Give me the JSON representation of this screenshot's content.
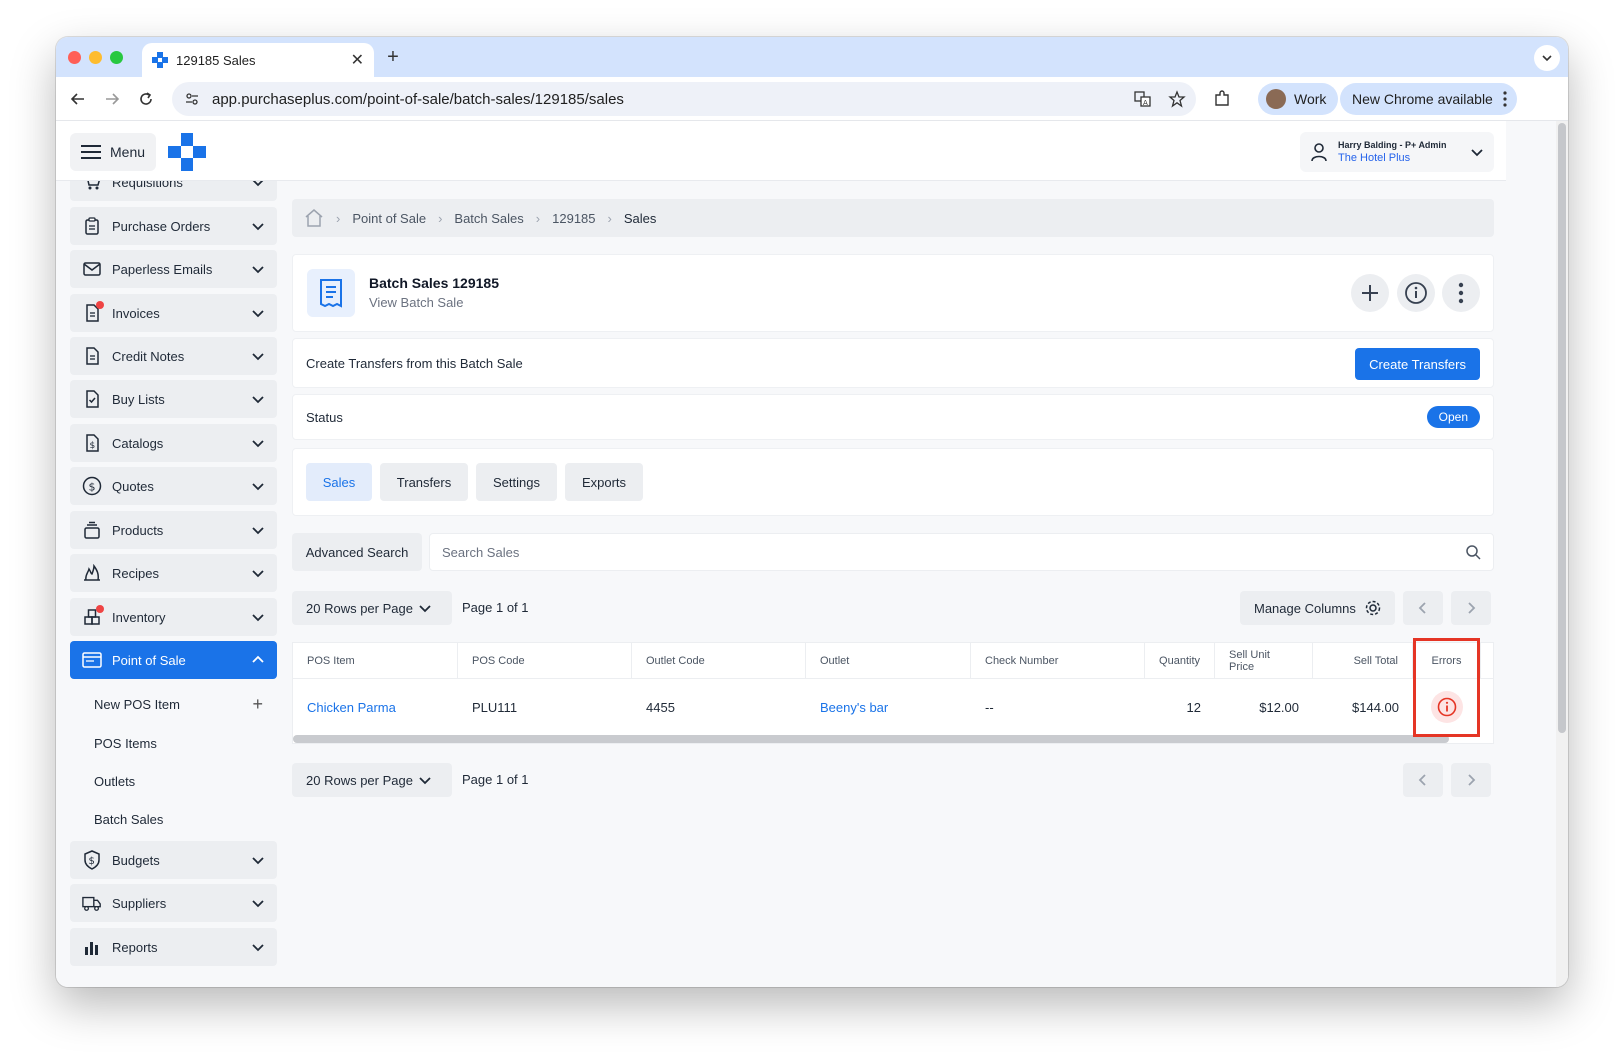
{
  "browser": {
    "tab_title": "129185 Sales",
    "url": "app.purchaseplus.com/point-of-sale/batch-sales/129185/sales",
    "profile_label": "Work",
    "update_label": "New Chrome available"
  },
  "header": {
    "menu_label": "Menu",
    "user_name": "Harry Balding - P+ Admin",
    "user_org": "The Hotel Plus"
  },
  "sidebar": {
    "items": [
      {
        "label": "Requisitions",
        "icon": "cart-icon"
      },
      {
        "label": "Purchase Orders",
        "icon": "clipboard-icon"
      },
      {
        "label": "Paperless Emails",
        "icon": "envelope-icon"
      },
      {
        "label": "Invoices",
        "icon": "invoice-icon"
      },
      {
        "label": "Credit Notes",
        "icon": "document-icon"
      },
      {
        "label": "Buy Lists",
        "icon": "checklist-icon"
      },
      {
        "label": "Catalogs",
        "icon": "catalog-dollar-icon"
      },
      {
        "label": "Quotes",
        "icon": "dollar-circle-icon"
      },
      {
        "label": "Products",
        "icon": "box-stack-icon"
      },
      {
        "label": "Recipes",
        "icon": "flame-icon"
      },
      {
        "label": "Inventory",
        "icon": "inventory-icon"
      },
      {
        "label": "Point of Sale",
        "icon": "pos-icon"
      },
      {
        "label": "Budgets",
        "icon": "shield-dollar-icon"
      },
      {
        "label": "Suppliers",
        "icon": "truck-icon"
      },
      {
        "label": "Reports",
        "icon": "bar-chart-icon"
      }
    ],
    "pos_sub_items": [
      "New POS Item",
      "POS Items",
      "Outlets",
      "Batch Sales"
    ]
  },
  "breadcrumb": [
    "Point of Sale",
    "Batch Sales",
    "129185",
    "Sales"
  ],
  "page": {
    "title": "Batch Sales 129185",
    "subtitle": "View Batch Sale",
    "transfers_text": "Create Transfers from this Batch Sale",
    "create_transfers_label": "Create Transfers",
    "status_label": "Status",
    "status_value": "Open"
  },
  "tabs": [
    "Sales",
    "Transfers",
    "Settings",
    "Exports"
  ],
  "search": {
    "advanced_label": "Advanced Search",
    "placeholder": "Search Sales"
  },
  "pagination": {
    "rows_per_page": "20 Rows per Page",
    "page_info": "Page 1 of 1",
    "manage_columns": "Manage Columns"
  },
  "table": {
    "columns": [
      "POS Item",
      "POS Code",
      "Outlet Code",
      "Outlet",
      "Check Number",
      "Quantity",
      "Sell Unit Price",
      "Sell Total",
      "Errors"
    ],
    "rows": [
      {
        "pos_item": "Chicken Parma",
        "pos_code": "PLU111",
        "outlet_code": "4455",
        "outlet": "Beeny's bar",
        "check_number": "--",
        "quantity": "12",
        "sell_unit_price": "$12.00",
        "sell_total": "$144.00"
      }
    ]
  },
  "colors": {
    "accent": "#1a73e8",
    "error": "#e53525",
    "badge_dot": "#ef4444"
  }
}
